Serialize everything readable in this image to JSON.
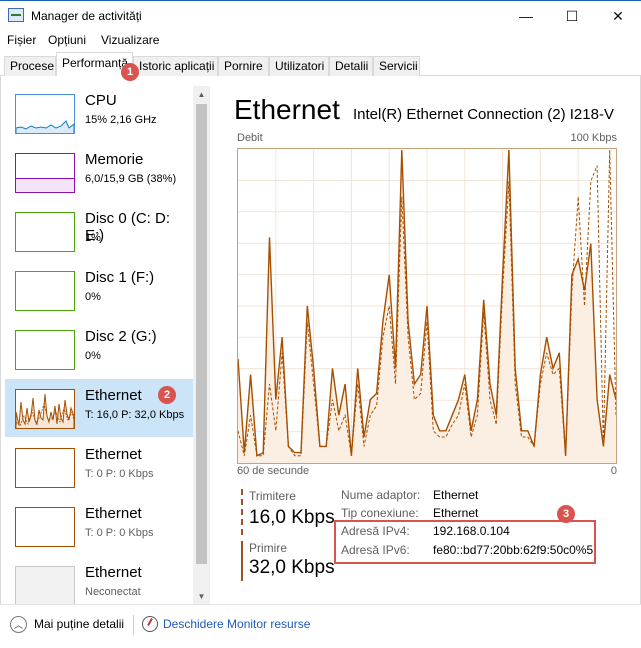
{
  "window": {
    "title": "Manager de activități",
    "minimize_glyph": "—",
    "maximize_glyph": "☐",
    "close_glyph": "✕"
  },
  "menu": [
    "Fișier",
    "Opțiuni",
    "Vizualizare"
  ],
  "tabs": [
    {
      "label": "Procese"
    },
    {
      "label": "Performanță",
      "active": true
    },
    {
      "label": "Istoric aplicații"
    },
    {
      "label": "Pornire"
    },
    {
      "label": "Utilizatori"
    },
    {
      "label": "Detalii"
    },
    {
      "label": "Servicii"
    }
  ],
  "sidebar": {
    "items": [
      {
        "title": "CPU",
        "sub": "15% 2,16 GHz",
        "color": "#117dbb"
      },
      {
        "title": "Memorie",
        "sub": "6,0/15,9 GB (38%)",
        "color": "#8b12ae"
      },
      {
        "title": "Disc 0 (C: D: E:)",
        "sub": "1%",
        "color": "#4da60c"
      },
      {
        "title": "Disc 1 (F:)",
        "sub": "0%",
        "color": "#4da60c"
      },
      {
        "title": "Disc 2 (G:)",
        "sub": "0%",
        "color": "#4da60c"
      },
      {
        "title": "Ethernet",
        "sub": "T: 16,0  P: 32,0 Kbps",
        "color": "#a74f01",
        "selected": true
      },
      {
        "title": "Ethernet",
        "sub": "T: 0  P: 0 Kbps",
        "color": "#a74f01"
      },
      {
        "title": "Ethernet",
        "sub": "T: 0  P: 0 Kbps",
        "color": "#a74f01"
      },
      {
        "title": "Ethernet",
        "sub": "Neconectat",
        "color": "#9a9a9a"
      }
    ],
    "scroll_up_glyph": "▲",
    "scroll_down_glyph": "▼"
  },
  "detail": {
    "title": "Ethernet",
    "adapter": "Intel(R) Ethernet Connection (2) I218-V",
    "graph_top_left": "Debit",
    "graph_top_right": "100 Kbps",
    "graph_bottom_left": "60 de secunde",
    "graph_bottom_right": "0",
    "send_label": "Trimitere",
    "send_value": "16,0 Kbps",
    "receive_label": "Primire",
    "receive_value": "32,0 Kbps",
    "info": [
      {
        "label": "Nume adaptor:",
        "value": "Ethernet"
      },
      {
        "label": "Tip conexiune:",
        "value": "Ethernet"
      },
      {
        "label": "Adresă IPv4:",
        "value": "192.168.0.104"
      },
      {
        "label": "Adresă IPv6:",
        "value": "fe80::bd77:20bb:62f9:50c0%5"
      }
    ]
  },
  "badges": [
    "1",
    "2",
    "3"
  ],
  "footer": {
    "fewer_details": "Mai puține detalii",
    "fewer_glyph": "︿",
    "resource_monitor": "Deschidere Monitor resurse"
  },
  "chart_data": {
    "type": "line",
    "title": "Debit",
    "xlabel": "60 de secunde",
    "ylabel": "",
    "ylim": [
      0,
      100
    ],
    "y_unit": "Kbps",
    "series": [
      {
        "name": "Primire",
        "style": "solid",
        "values": [
          33,
          3,
          28,
          2,
          3,
          72,
          20,
          40,
          5,
          3,
          3,
          50,
          30,
          5,
          5,
          30,
          15,
          25,
          2,
          30,
          8,
          20,
          22,
          45,
          60,
          30,
          100,
          45,
          25,
          28,
          50,
          15,
          10,
          10,
          15,
          20,
          28,
          10,
          20,
          52,
          25,
          15,
          60,
          100,
          30,
          10,
          10,
          5,
          28,
          40,
          30,
          35,
          2,
          60,
          65,
          55,
          70,
          20,
          5,
          28,
          20
        ]
      },
      {
        "name": "Trimitere",
        "style": "dashed",
        "values": [
          10,
          2,
          15,
          2,
          2,
          25,
          10,
          35,
          5,
          2,
          2,
          45,
          25,
          5,
          5,
          20,
          10,
          15,
          2,
          25,
          5,
          15,
          18,
          40,
          50,
          25,
          85,
          40,
          20,
          22,
          45,
          10,
          8,
          8,
          12,
          15,
          25,
          8,
          15,
          48,
          20,
          12,
          55,
          90,
          25,
          8,
          8,
          5,
          25,
          35,
          28,
          30,
          2,
          55,
          85,
          50,
          90,
          95,
          5,
          100,
          15
        ]
      }
    ]
  }
}
